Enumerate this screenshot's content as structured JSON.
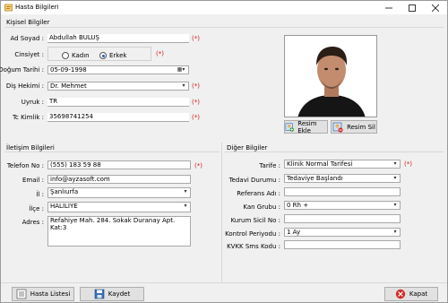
{
  "window": {
    "title": "Hasta Bilgileri"
  },
  "personal": {
    "group_title": "Kişisel Bilgiler",
    "name_label": "Ad Soyad :",
    "name_value": "Abdullah BULUŞ",
    "gender_label": "Cinsiyet :",
    "gender_options": [
      "Kadın",
      "Erkek"
    ],
    "gender_selected": "Erkek",
    "birth_label": "Doğum Tarihi :",
    "birth_value": "05-09-1998",
    "doctor_label": "Diş Hekimi :",
    "doctor_value": "Dr. Mehmet",
    "nationality_label": "Uyruk :",
    "nationality_value": "TR",
    "tc_label": "Tc Kimlik :",
    "tc_value": "35698741254",
    "required_mark": "(*)"
  },
  "photo": {
    "add_label": "Resim Ekle",
    "delete_label": "Resim Sil"
  },
  "contact": {
    "group_title": "İletişim Bilgileri",
    "phone_label": "Telefon No :",
    "phone_value": "(555) 183 59 88",
    "email_label": "Email :",
    "email_value": "info@ayzasoft.com",
    "city_label": "İl :",
    "city_value": "Şanlıurfa",
    "district_label": "İlçe :",
    "district_value": "HALİLİYE",
    "address_label": "Adres :",
    "address_value": "Refahiye Mah. 284. Sokak Duranay Apt. Kat:3"
  },
  "other": {
    "group_title": "Diğer Bilgiler",
    "tariff_label": "Tarife :",
    "tariff_value": "Klinik Normal Tarifesi",
    "treatment_label": "Tedavi Durumu :",
    "treatment_value": "Tedaviye Başlandı",
    "reference_label": "Referans Adı :",
    "reference_value": "",
    "blood_label": "Kan Grubu :",
    "blood_value": "0 Rh +",
    "board_label": "Kurum Sicil No :",
    "board_value": "",
    "period_label": "Kontrol Periyodu :",
    "period_value": "1 Ay",
    "kvkk_label": "KVKK Sms Kodu :",
    "kvkk_value": ""
  },
  "footer": {
    "list_label": "Hasta Listesi",
    "save_label": "Kaydet",
    "close_label": "Kapat"
  }
}
